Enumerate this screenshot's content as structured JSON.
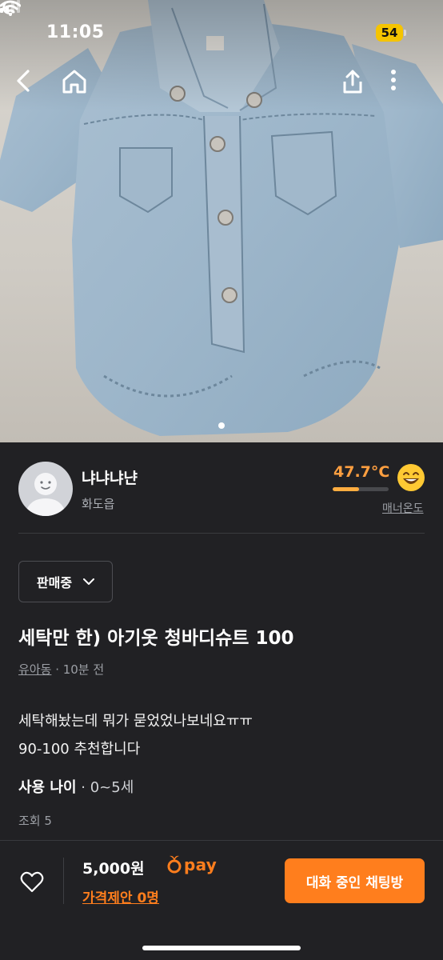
{
  "status_bar": {
    "time": "11:05",
    "battery": "54"
  },
  "nav": {
    "back_icon": "chevron-left-icon",
    "home_icon": "home-icon",
    "share_icon": "share-icon",
    "more_icon": "more-vertical-icon"
  },
  "photo": {
    "pages_shown": 1
  },
  "seller": {
    "name": "냐냐냐냔",
    "location": "화도읍",
    "temperature": "47.7°C",
    "temperature_level": 0.477,
    "manner_label": "매너온도"
  },
  "post": {
    "status": "판매중",
    "title": "세탁만 한) 아기옷 청바디슈트 100",
    "category": "유아동",
    "time_ago": "· 10분 전",
    "description_line1": "세탁해놨는데 뭐가 묻었었나보네요ㅠㅠ",
    "description_line2": "90-100 추천합니다",
    "age_label": "사용 나이",
    "age_sep": "·",
    "age_value": "0~5세",
    "views": "조회 5"
  },
  "bottom_bar": {
    "price": "5,000원",
    "pay_label": "pay",
    "offer": "가격제안 0명",
    "chat_button": "대화 중인 채팅방"
  },
  "colors": {
    "accent": "#ff7e1d",
    "background": "#212124",
    "temperature": "#ff9f40"
  }
}
